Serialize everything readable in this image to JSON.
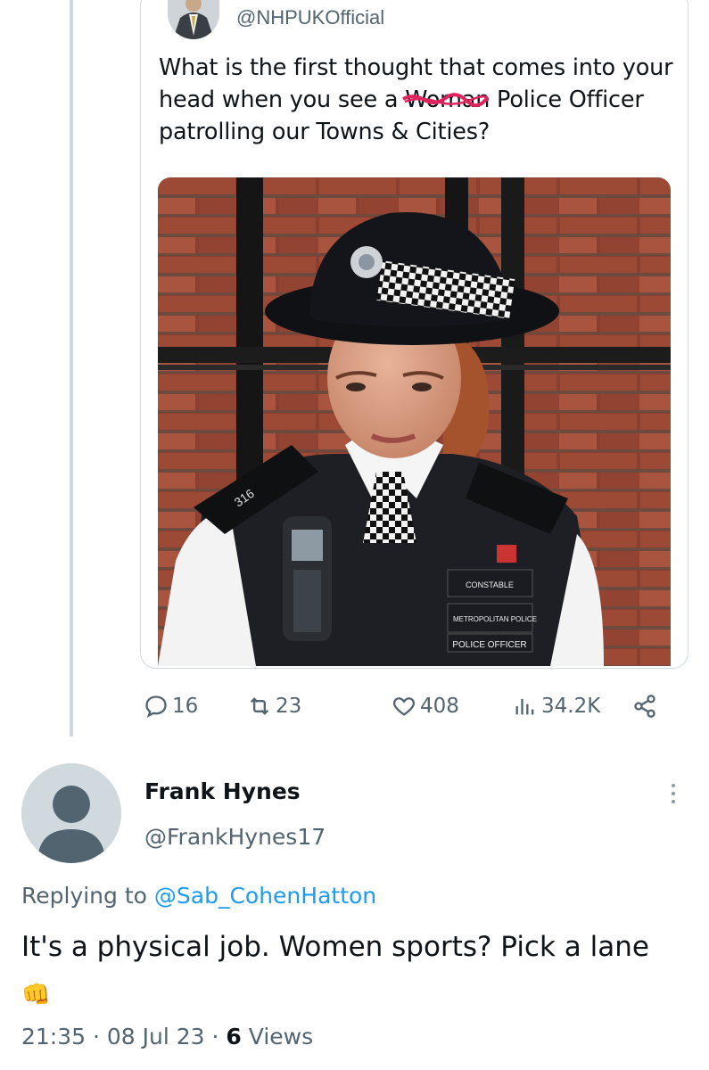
{
  "quoted_tweet": {
    "handle": "@NHPUKOfficial",
    "text_before": "What is the first thought that comes into your head when you see a ",
    "struck_word": "Woman",
    "text_after": " Police Officer patrolling our Towns & Cities?",
    "image_alt": "Photo of a female police officer in uniform",
    "image_text": {
      "rank_badge": "CONSTABLE",
      "org_badge": "METROPOLITAN POLICE",
      "role_badge": "POLICE OFFICER"
    }
  },
  "actions": {
    "replies": "16",
    "retweets": "23",
    "likes": "408",
    "views": "34.2K"
  },
  "reply": {
    "display_name": "Frank Hynes",
    "handle": "@FrankHynes17",
    "replying_prefix": "Replying to ",
    "replying_to": "@Sab_CohenHatton",
    "text": "It's a physical job. Women sports? Pick a lane",
    "emoji": "👊",
    "time": "21:35",
    "date": "08 Jul 23",
    "views_count": "6",
    "views_label": "Views"
  },
  "colors": {
    "text": "#0f1419",
    "secondary": "#536471",
    "link": "#1d9bf0",
    "border": "#cfd9de",
    "strike": "#e0245e"
  }
}
